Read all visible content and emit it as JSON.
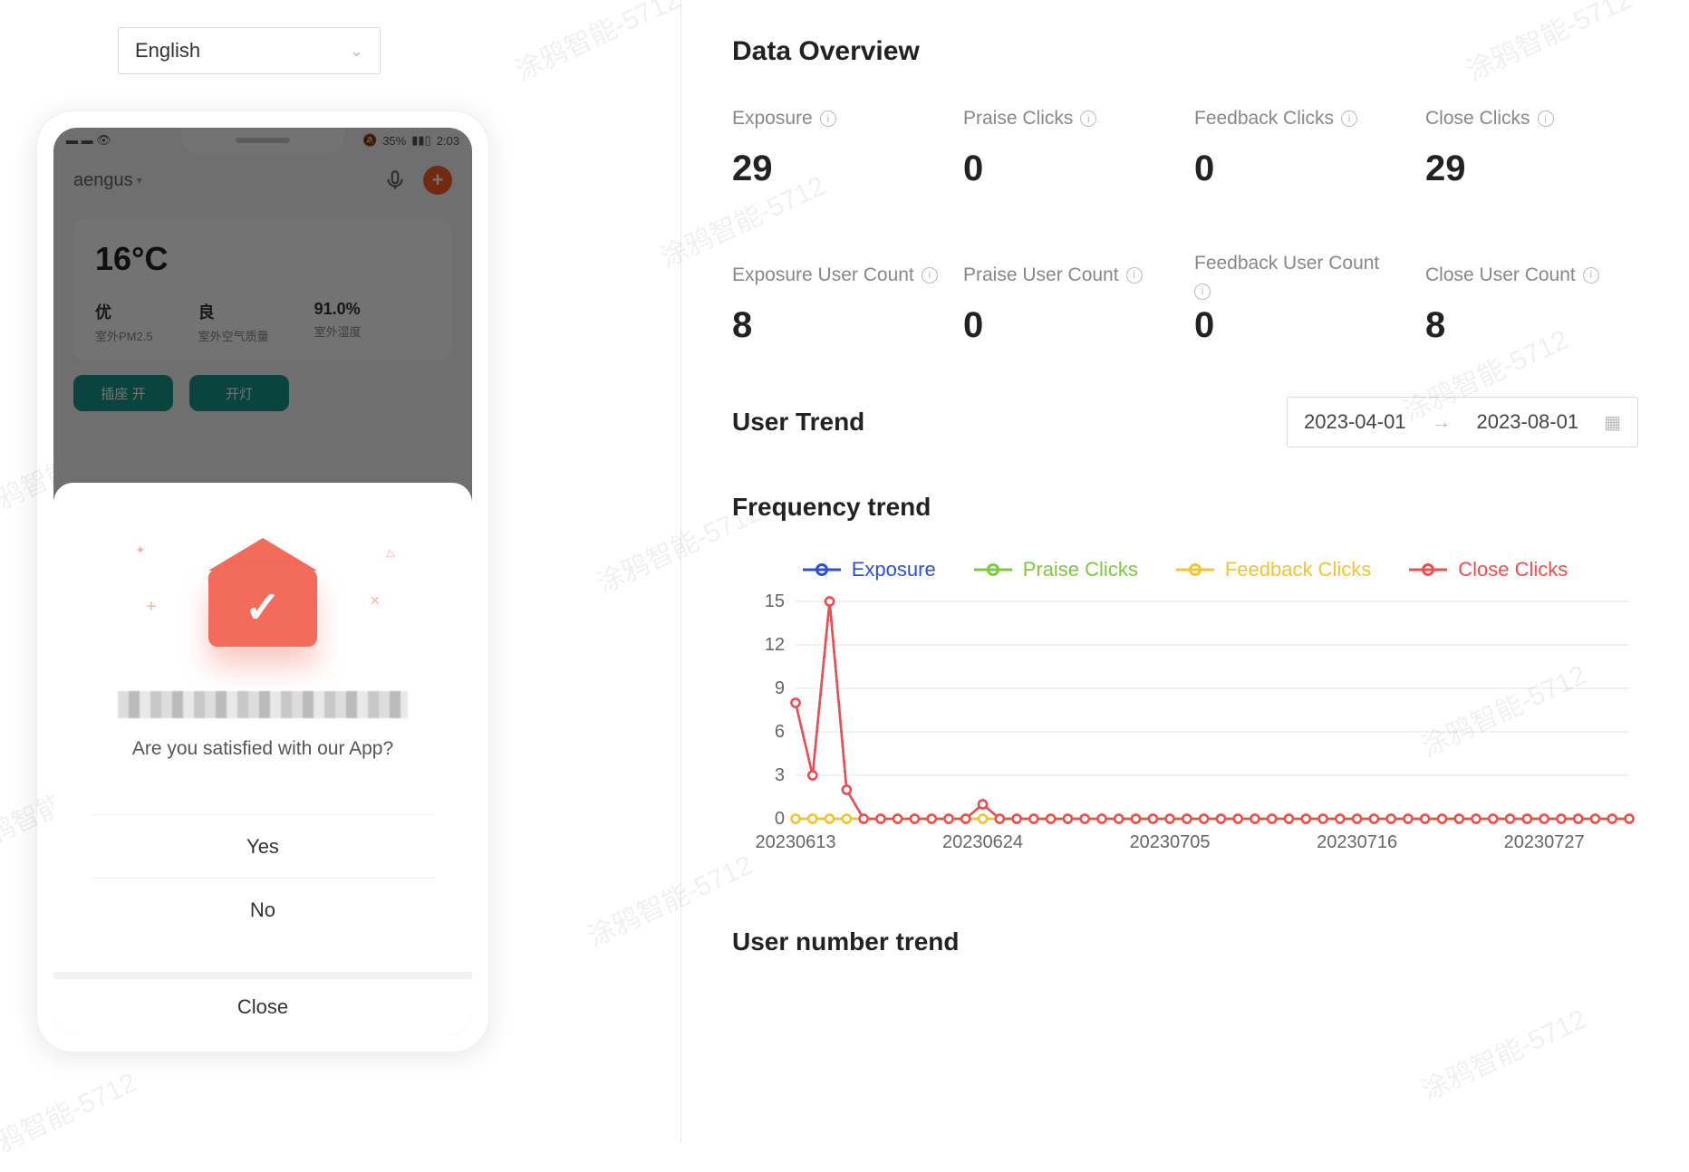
{
  "language_selector": {
    "value": "English"
  },
  "phone": {
    "status": {
      "left": "▬ ▬ 👁",
      "right_mute": "🔕",
      "right_signal": "35%",
      "right_battery": "▮▮▯",
      "right_time": "2:03"
    },
    "user": "aengus",
    "temperature": "16°C",
    "weather": [
      {
        "value": "优",
        "label": "室外PM2.5"
      },
      {
        "value": "良",
        "label": "室外空气质量"
      },
      {
        "value": "91.0%",
        "label": "室外湿度"
      }
    ],
    "pills": [
      "插座  开",
      "开灯"
    ]
  },
  "dialog": {
    "question": "Are you satisfied with our App?",
    "yes": "Yes",
    "no": "No",
    "close": "Close"
  },
  "overview": {
    "title": "Data Overview",
    "stats_row1": [
      {
        "label": "Exposure",
        "value": "29"
      },
      {
        "label": "Praise Clicks",
        "value": "0"
      },
      {
        "label": "Feedback Clicks",
        "value": "0"
      },
      {
        "label": "Close Clicks",
        "value": "29"
      }
    ],
    "stats_row2": [
      {
        "label": "Exposure User Count",
        "value": "8"
      },
      {
        "label": "Praise User Count",
        "value": "0"
      },
      {
        "label": "Feedback User Count",
        "value": "0"
      },
      {
        "label": "Close User Count",
        "value": "8"
      }
    ]
  },
  "user_trend": {
    "title": "User Trend",
    "date_from": "2023-04-01",
    "date_to": "2023-08-01"
  },
  "frequency_trend": {
    "title": "Frequency trend"
  },
  "legend": {
    "exposure": "Exposure",
    "praise": "Praise Clicks",
    "feedback": "Feedback Clicks",
    "close": "Close Clicks"
  },
  "chart_data": {
    "type": "line",
    "xlabels_shown": [
      "20230613",
      "20230624",
      "20230705",
      "20230716",
      "20230727"
    ],
    "x": [
      "20230613",
      "20230614",
      "20230615",
      "20230616",
      "20230617",
      "20230618",
      "20230619",
      "20230620",
      "20230621",
      "20230622",
      "20230623",
      "20230624",
      "20230625",
      "20230626",
      "20230627",
      "20230628",
      "20230629",
      "20230630",
      "20230701",
      "20230702",
      "20230703",
      "20230704",
      "20230705",
      "20230706",
      "20230707",
      "20230708",
      "20230709",
      "20230710",
      "20230711",
      "20230712",
      "20230713",
      "20230714",
      "20230715",
      "20230716",
      "20230717",
      "20230718",
      "20230719",
      "20230720",
      "20230721",
      "20230722",
      "20230723",
      "20230724",
      "20230725",
      "20230726",
      "20230727",
      "20230728",
      "20230729",
      "20230730",
      "20230731",
      "20230801"
    ],
    "ylim": [
      0,
      15
    ],
    "yticks": [
      0,
      3,
      6,
      9,
      12,
      15
    ],
    "series": [
      {
        "name": "Exposure",
        "color": "#2a52d4",
        "values": [
          8,
          3,
          15,
          2,
          0,
          0,
          0,
          0,
          0,
          0,
          0,
          1,
          0,
          0,
          0,
          0,
          0,
          0,
          0,
          0,
          0,
          0,
          0,
          0,
          0,
          0,
          0,
          0,
          0,
          0,
          0,
          0,
          0,
          0,
          0,
          0,
          0,
          0,
          0,
          0,
          0,
          0,
          0,
          0,
          0,
          0,
          0,
          0,
          0,
          0
        ]
      },
      {
        "name": "Praise Clicks",
        "color": "#7cc93b",
        "values": [
          0,
          0,
          0,
          0,
          0,
          0,
          0,
          0,
          0,
          0,
          0,
          0,
          0,
          0,
          0,
          0,
          0,
          0,
          0,
          0,
          0,
          0,
          0,
          0,
          0,
          0,
          0,
          0,
          0,
          0,
          0,
          0,
          0,
          0,
          0,
          0,
          0,
          0,
          0,
          0,
          0,
          0,
          0,
          0,
          0,
          0,
          0,
          0,
          0,
          0
        ]
      },
      {
        "name": "Feedback Clicks",
        "color": "#f2c430",
        "values": [
          0,
          0,
          0,
          0,
          0,
          0,
          0,
          0,
          0,
          0,
          0,
          0,
          0,
          0,
          0,
          0,
          0,
          0,
          0,
          0,
          0,
          0,
          0,
          0,
          0,
          0,
          0,
          0,
          0,
          0,
          0,
          0,
          0,
          0,
          0,
          0,
          0,
          0,
          0,
          0,
          0,
          0,
          0,
          0,
          0,
          0,
          0,
          0,
          0,
          0
        ]
      },
      {
        "name": "Close Clicks",
        "color": "#f24d4d",
        "values": [
          8,
          3,
          15,
          2,
          0,
          0,
          0,
          0,
          0,
          0,
          0,
          1,
          0,
          0,
          0,
          0,
          0,
          0,
          0,
          0,
          0,
          0,
          0,
          0,
          0,
          0,
          0,
          0,
          0,
          0,
          0,
          0,
          0,
          0,
          0,
          0,
          0,
          0,
          0,
          0,
          0,
          0,
          0,
          0,
          0,
          0,
          0,
          0,
          0,
          0
        ]
      }
    ]
  },
  "user_number_trend": {
    "title": "User number trend"
  },
  "watermark": "涂鸦智能-5712"
}
